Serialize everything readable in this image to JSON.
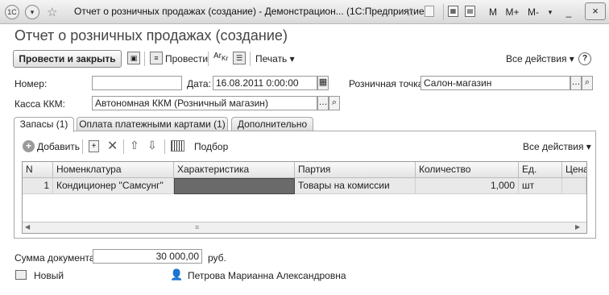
{
  "window": {
    "title": "Отчет о розничных продажах (создание) - Демонстрацион...  (1С:Предприятие)",
    "buttons": {
      "m": "M",
      "m_plus": "M+",
      "m_minus": "M-",
      "minimize": "_",
      "close": "×"
    },
    "app_icon": "1C"
  },
  "document": {
    "title": "Отчет о розничных продажах (создание)"
  },
  "toolbar": {
    "post_close": "Провести и закрыть",
    "post": "Провести",
    "print": "Печать ▾",
    "all_actions": "Все действия ▾",
    "help": "?"
  },
  "fields": {
    "number_label": "Номер:",
    "number_value": "",
    "date_label": "Дата:",
    "date_value": "16.08.2011  0:00:00",
    "outlet_label": "Розничная точка:",
    "outlet_value": "Салон-магазин",
    "register_label": "Касса ККМ:",
    "register_value": "Автономная ККМ (Розничный магазин)"
  },
  "tabs": [
    {
      "label": "Запасы (1)",
      "active": true
    },
    {
      "label": "Оплата платежными картами (1)",
      "active": false
    },
    {
      "label": "Дополнительно",
      "active": false
    }
  ],
  "panel_toolbar": {
    "add": "Добавить",
    "pick": "Подбор",
    "all_actions": "Все действия ▾"
  },
  "table": {
    "columns": [
      "N",
      "Номенклатура",
      "Характеристика",
      "Партия",
      "Количество",
      "Ед.",
      "Цена"
    ],
    "rows": [
      {
        "n": "1",
        "item": "Кондиционер \"Самсунг\"",
        "characteristic": "",
        "batch": "Товары на комиссии",
        "quantity": "1,000",
        "unit": "шт",
        "price": ""
      }
    ]
  },
  "totals": {
    "label": "Сумма документа:",
    "value": "30 000,00",
    "currency": "руб."
  },
  "status": {
    "state": "Новый",
    "author": "Петрова Марианна Александровна"
  }
}
